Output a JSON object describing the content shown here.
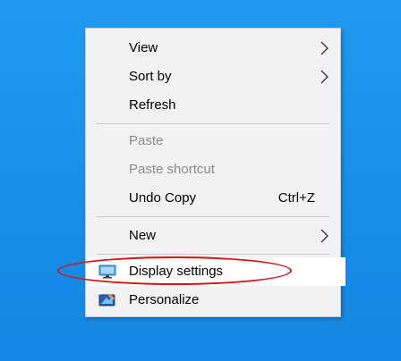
{
  "menu": {
    "items": [
      {
        "label": "View",
        "submenu": true
      },
      {
        "label": "Sort by",
        "submenu": true
      },
      {
        "label": "Refresh"
      },
      {
        "label": "Paste",
        "disabled": true
      },
      {
        "label": "Paste shortcut",
        "disabled": true
      },
      {
        "label": "Undo Copy",
        "shortcut": "Ctrl+Z"
      },
      {
        "label": "New",
        "submenu": true
      },
      {
        "label": "Display settings",
        "icon": "display-icon",
        "highlighted": true
      },
      {
        "label": "Personalize",
        "icon": "personalize-icon"
      }
    ]
  },
  "colors": {
    "desktop": "#1a92e8",
    "menu_bg": "#f2f2f2",
    "highlight": "#ffffff",
    "annotation": "#d21414",
    "disabled_text": "#8a8a8a"
  }
}
